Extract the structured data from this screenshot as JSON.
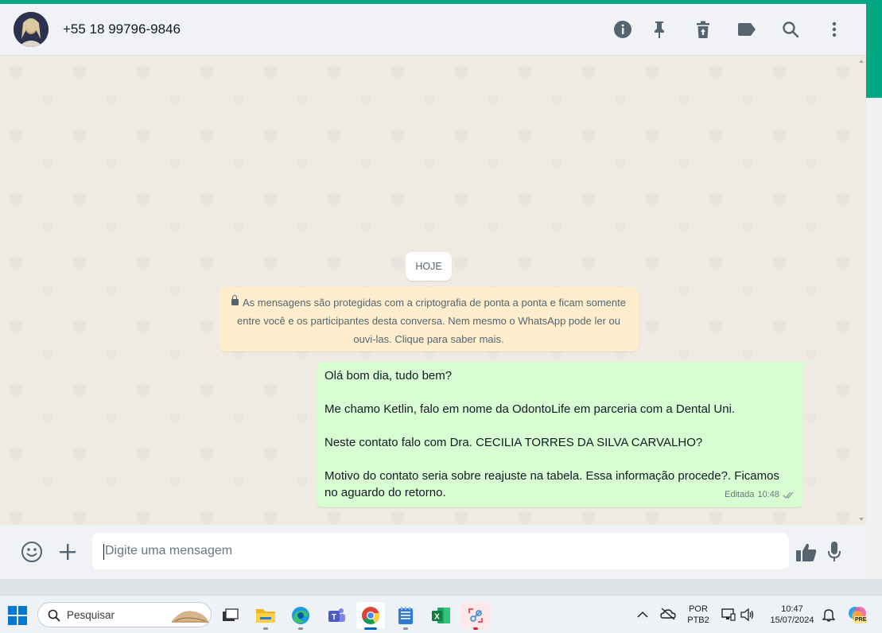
{
  "chat": {
    "contact_name": "+55 18 99796-9846",
    "header_icons": [
      "info-icon",
      "pin-icon",
      "delete-icon",
      "label-icon",
      "search-icon",
      "menu-icon"
    ],
    "day_divider": "HOJE",
    "encryption_notice": "As mensagens são protegidas com a criptografia de ponta a ponta e ficam somente entre você e os participantes desta conversa. Nem mesmo o WhatsApp pode ler ou ouvi-las. Clique para saber mais.",
    "message": {
      "line1": "Olá bom dia, tudo bem?",
      "line2": "Me chamo Ketlin, falo em nome da OdontoLife em parceria com a Dental Uni.",
      "line3": "Neste contato falo com Dra. CECILIA TORRES DA SILVA CARVALHO?",
      "line4": "Motivo do contato seria sobre reajuste na tabela. Essa informação procede?. Ficamos no aguardo do retorno.",
      "edited_label": "Editada",
      "time": "10:48",
      "status_icon": "double-check-icon"
    },
    "composer": {
      "placeholder": "Digite uma mensagem",
      "left_icons": [
        "emoji-icon",
        "plus-icon"
      ],
      "right_icons": [
        "thumbs-up-icon",
        "microphone-icon"
      ]
    }
  },
  "colors": {
    "accent": "#00a884",
    "bubble_out": "#d9fdd3",
    "notice_bg": "#ffeecd",
    "chat_bg": "#efeae2"
  },
  "taskbar": {
    "search_label": "Pesquisar",
    "apps": [
      "task-view",
      "file-explorer",
      "edge",
      "teams",
      "chrome",
      "notepad",
      "excel",
      "snipping-tool"
    ],
    "language_line1": "POR",
    "language_line2": "PTB2",
    "time": "10:47",
    "date": "15/07/2024",
    "copilot_badge": "PRE"
  }
}
